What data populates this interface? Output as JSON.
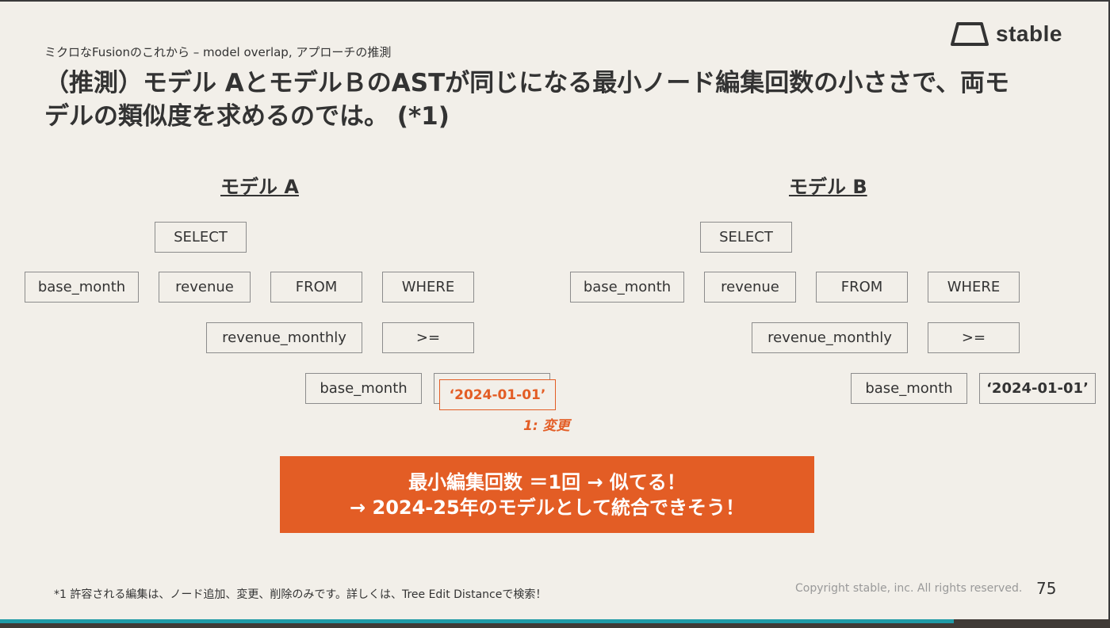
{
  "header": {
    "subtitle": "ミクロなFusionのこれから – model overlap, アプローチの推測",
    "title": "（推測）モデル AとモデルＢのASTが同じになる最小ノード編集回数の小ささで、両モデルの類似度を求めるのでは。 (*1)"
  },
  "logo": {
    "text": "stable",
    "icon": "trapezoid-logo-icon"
  },
  "model_a": {
    "label": "モデル A",
    "nodes": {
      "select": "SELECT",
      "base_month": "base_month",
      "revenue": "revenue",
      "from": "FROM",
      "where": "WHERE",
      "revenue_monthly": "revenue_monthly",
      "gte": ">=",
      "base_month_2": "base_month",
      "date_value": "‘2024-01-01’"
    },
    "change_label": "1: 変更"
  },
  "model_b": {
    "label": "モデル B",
    "nodes": {
      "select": "SELECT",
      "base_month": "base_month",
      "revenue": "revenue",
      "from": "FROM",
      "where": "WHERE",
      "revenue_monthly": "revenue_monthly",
      "gte": ">=",
      "base_month_2": "base_month",
      "date_value": "‘2024-01-01’"
    }
  },
  "banner": {
    "line1": "最小編集回数 ＝1回 → 似てる！",
    "line2": "→ 2024-25年のモデルとして統合できそう！"
  },
  "footer": {
    "footnote": "*1 許容される編集は、ノード追加、変更、削除のみです。詳しくは、Tree Edit Distanceで検索！",
    "copyright": "Copyright stable, inc. All rights reserved.",
    "page_number": "75"
  },
  "colors": {
    "accent": "#e35d25",
    "background": "#f2efe9",
    "text": "#333333",
    "progress": "#1f9aa6"
  }
}
